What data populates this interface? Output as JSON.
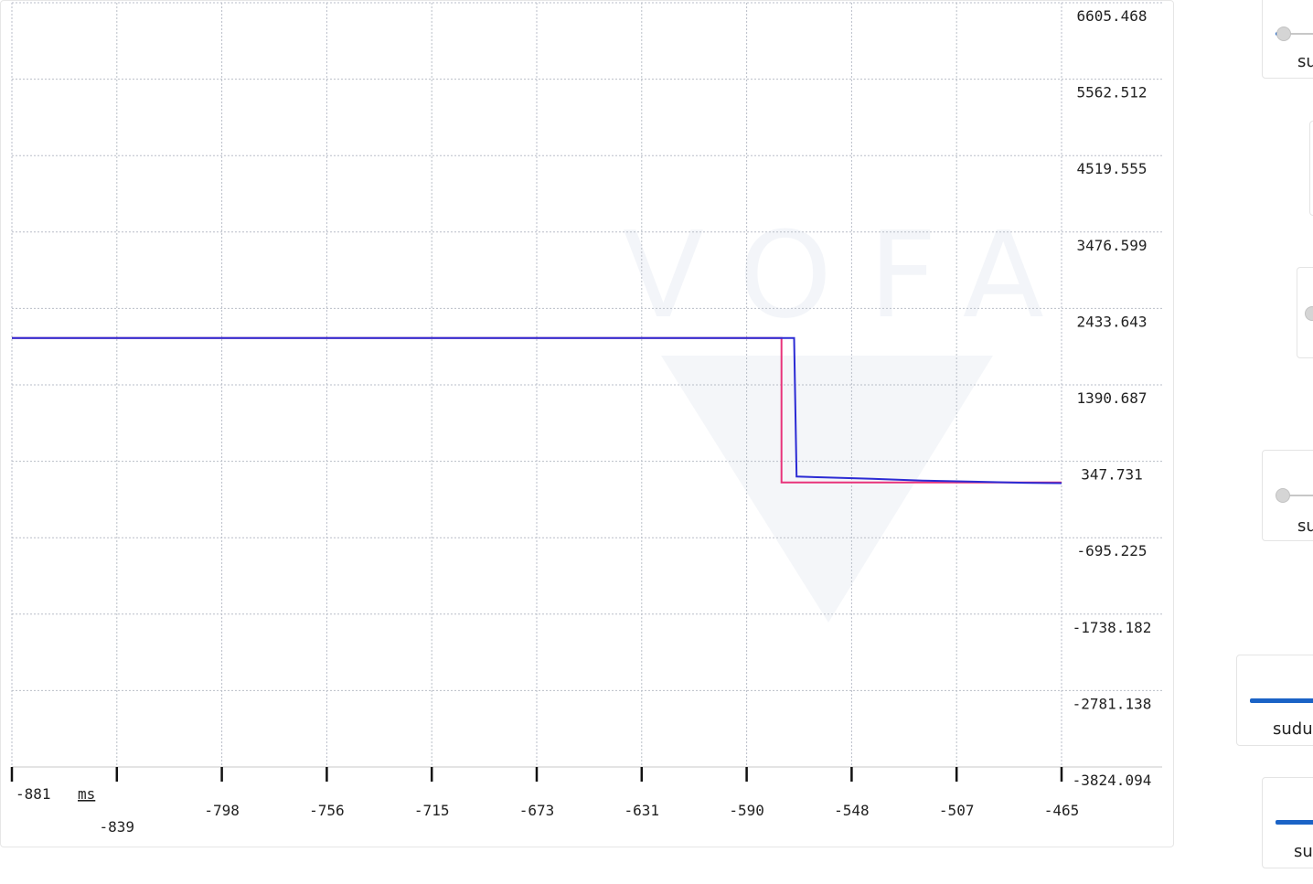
{
  "chart_data": {
    "type": "line",
    "watermark": "VOFA",
    "x_unit": "ms",
    "x_ticks": [
      "-881",
      "-839",
      "-798",
      "-756",
      "-715",
      "-673",
      "-631",
      "-590",
      "-548",
      "-507",
      "-465"
    ],
    "y_ticks": [
      "6605.468",
      "5562.512",
      "4519.555",
      "3476.599",
      "2433.643",
      "1390.687",
      "347.731",
      "-695.225",
      "-1738.182",
      "-2781.138",
      "-3824.094"
    ],
    "xlim": [
      -881,
      -465
    ],
    "ylim": [
      -3824.094,
      6605.468
    ],
    "grid": true,
    "series": [
      {
        "color": "#e8337a",
        "points": [
          [
            -881,
            2030
          ],
          [
            -576,
            2030
          ],
          [
            -576,
            60
          ],
          [
            -560,
            60
          ],
          [
            -465,
            60
          ]
        ]
      },
      {
        "color": "#2b2bd4",
        "points": [
          [
            -881,
            2030
          ],
          [
            -571,
            2030
          ],
          [
            -570,
            140
          ],
          [
            -560,
            130
          ],
          [
            -540,
            110
          ],
          [
            -520,
            85
          ],
          [
            -500,
            70
          ],
          [
            -480,
            55
          ],
          [
            -465,
            50
          ]
        ]
      }
    ]
  },
  "side_panel": {
    "labels": [
      "su",
      "su",
      "sudu",
      "su"
    ],
    "slider_levels": [
      0.08,
      0.0
    ]
  }
}
